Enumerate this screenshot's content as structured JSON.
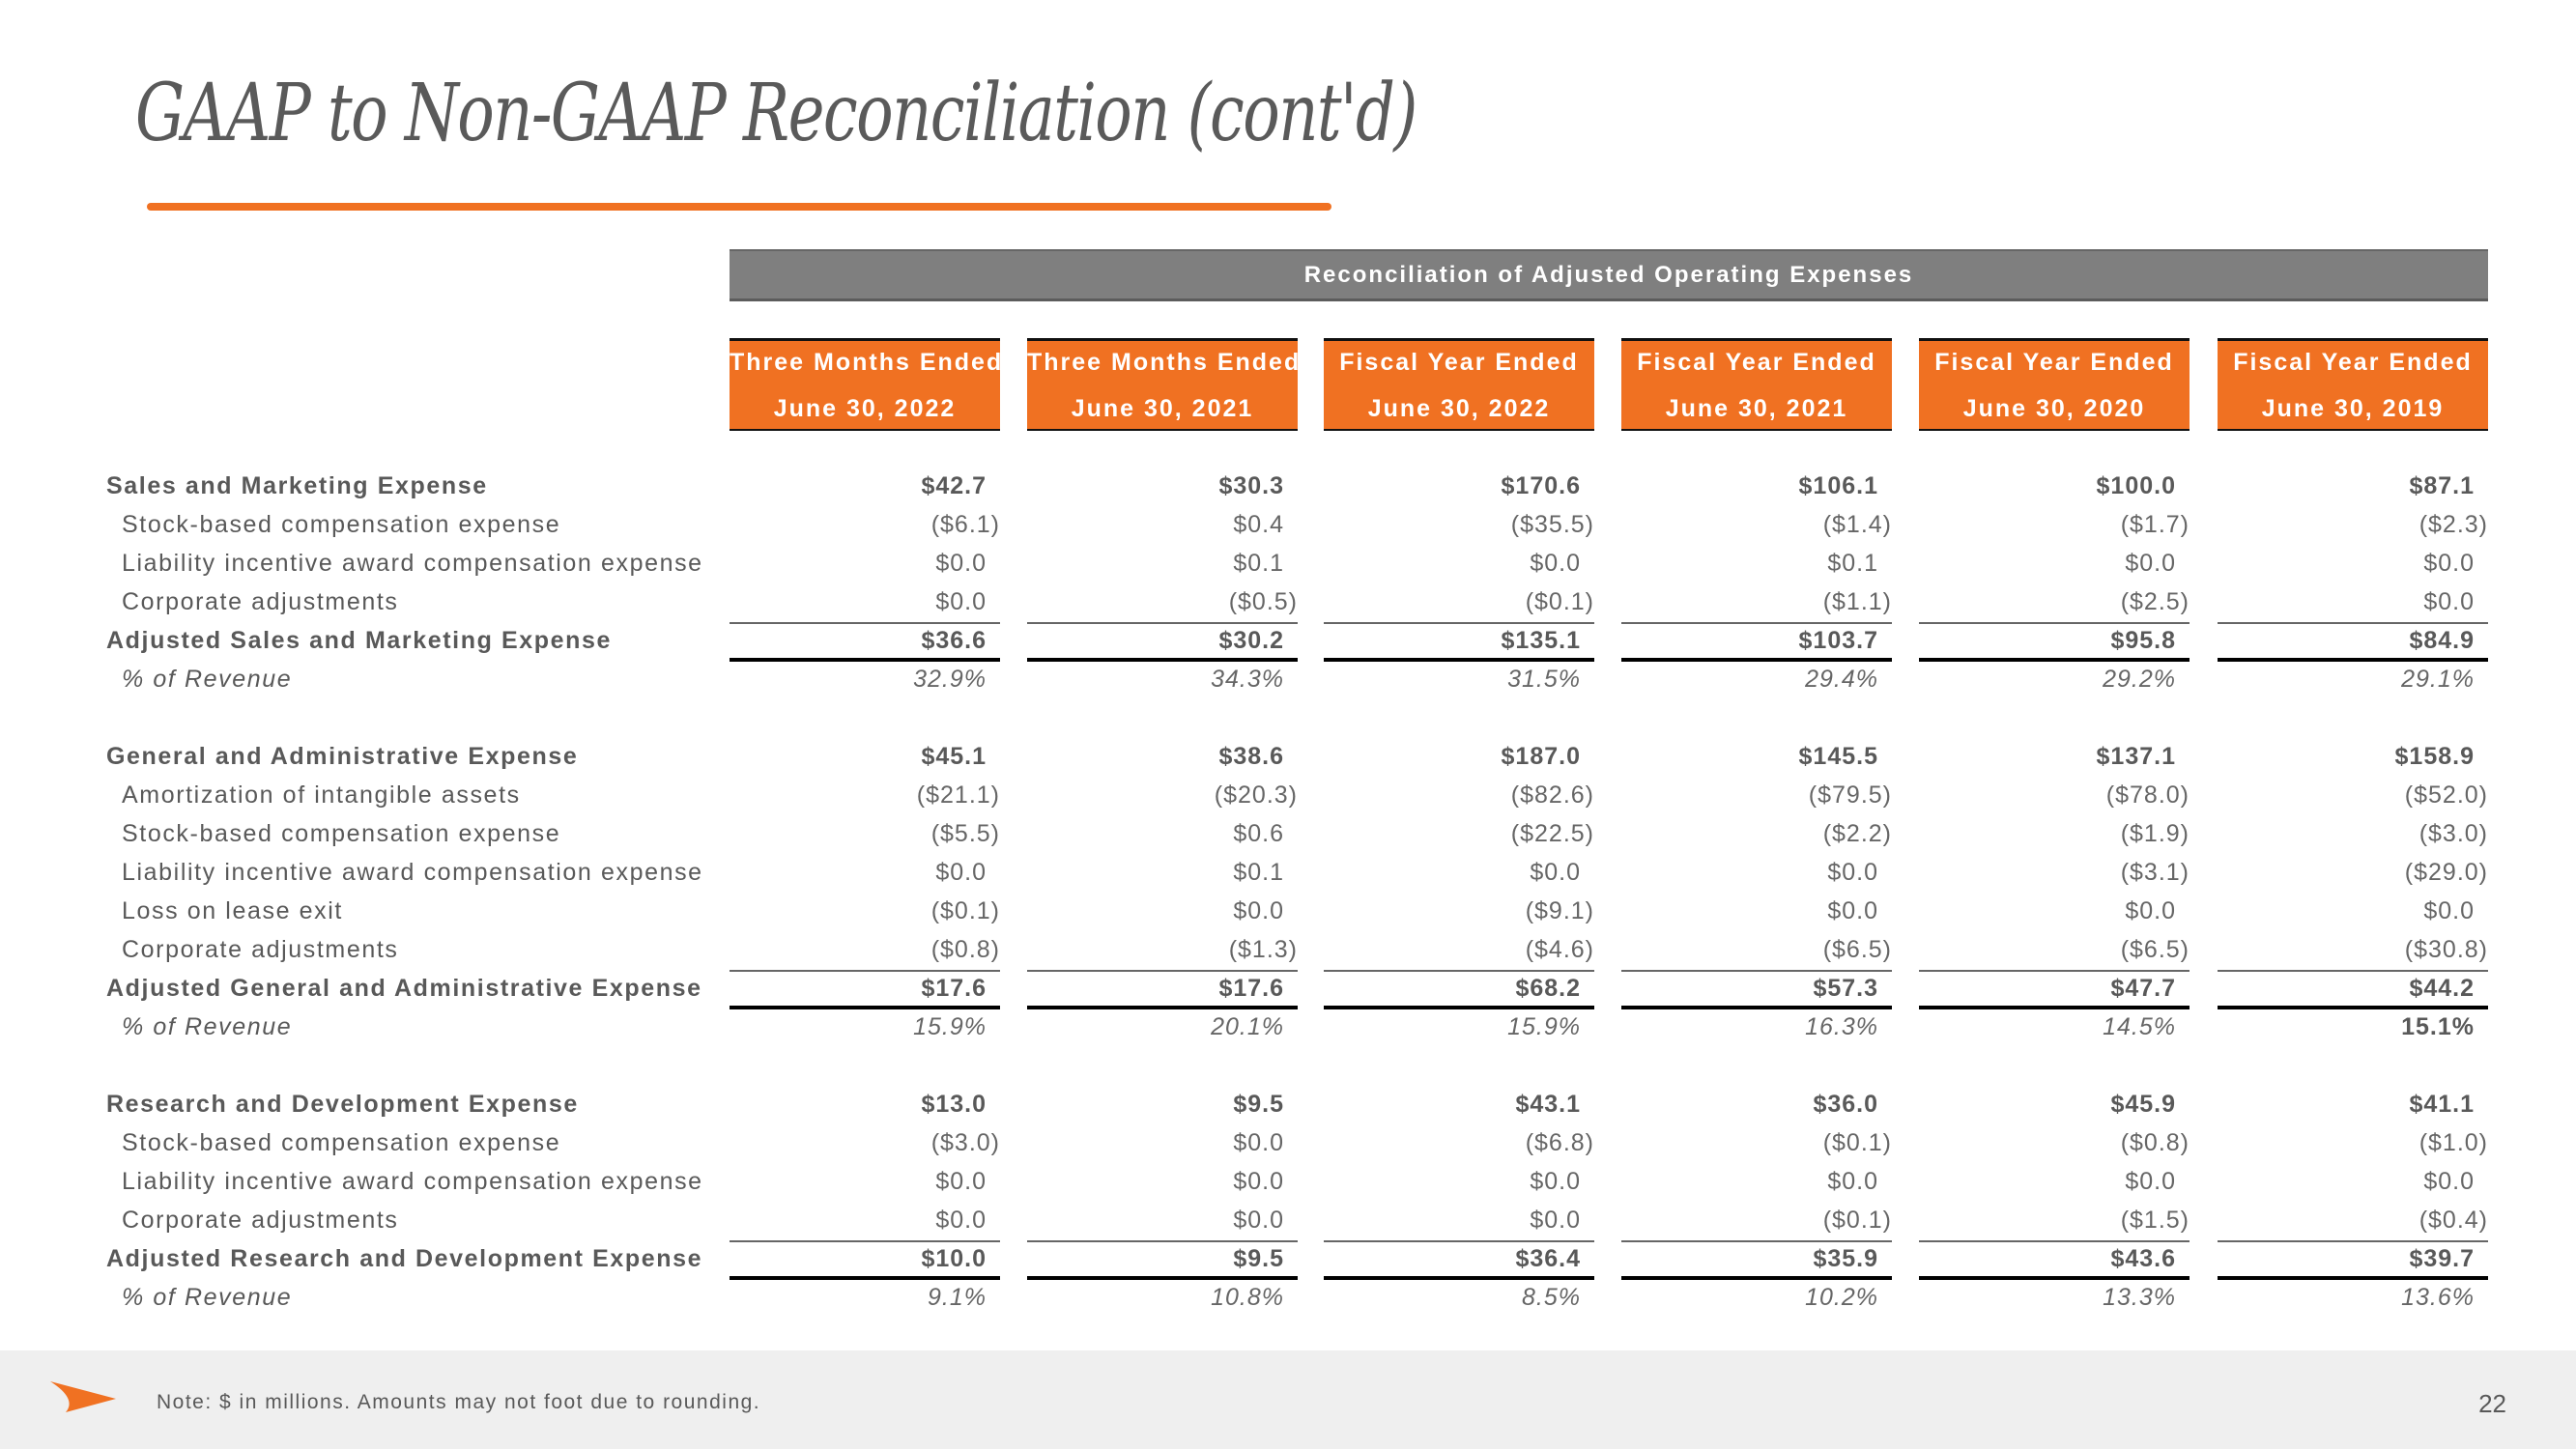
{
  "slide": {
    "title": "GAAP to Non-GAAP Reconciliation (cont'd)",
    "banner": "Reconciliation of Adjusted Operating Expenses",
    "accent_color": "#f07122",
    "banner_color": "#7f7f7f",
    "page_number": "22",
    "footer_note": "Note: $ in millions. Amounts may not foot due to rounding.",
    "footer_icon": "orange-arrow-logo-icon"
  },
  "columns": [
    {
      "line1": "Three Months Ended",
      "line2": "June 30, 2022"
    },
    {
      "line1": "Three Months Ended",
      "line2": "June 30, 2021"
    },
    {
      "line1": "Fiscal Year Ended",
      "line2": "June 30, 2022"
    },
    {
      "line1": "Fiscal Year Ended",
      "line2": "June 30, 2021"
    },
    {
      "line1": "Fiscal Year Ended",
      "line2": "June 30, 2020"
    },
    {
      "line1": "Fiscal Year Ended",
      "line2": "June 30, 2019"
    }
  ],
  "sections": [
    {
      "name": "sales-marketing",
      "rows": [
        {
          "label": "Sales and Marketing Expense",
          "style": "bold",
          "values": [
            "$42.7",
            "$30.3",
            "$170.6",
            "$106.1",
            "$100.0",
            "$87.1"
          ]
        },
        {
          "label": "Stock-based compensation expense",
          "style": "sub",
          "values": [
            "($6.1)",
            "$0.4",
            "($35.5)",
            "($1.4)",
            "($1.7)",
            "($2.3)"
          ]
        },
        {
          "label": "Liability incentive award compensation expense",
          "style": "sub",
          "values": [
            "$0.0",
            "$0.1",
            "$0.0",
            "$0.1",
            "$0.0",
            "$0.0"
          ]
        },
        {
          "label": "Corporate adjustments",
          "style": "sub",
          "values": [
            "$0.0",
            "($0.5)",
            "($0.1)",
            "($1.1)",
            "($2.5)",
            "$0.0"
          ]
        },
        {
          "label": "Adjusted Sales and Marketing Expense",
          "style": "total",
          "values": [
            "$36.6",
            "$30.2",
            "$135.1",
            "$103.7",
            "$95.8",
            "$84.9"
          ]
        },
        {
          "label": "% of Revenue",
          "style": "pct",
          "values": [
            "32.9%",
            "34.3%",
            "31.5%",
            "29.4%",
            "29.2%",
            "29.1%"
          ]
        }
      ]
    },
    {
      "name": "general-administrative",
      "rows": [
        {
          "label": "General and Administrative Expense",
          "style": "bold",
          "values": [
            "$45.1",
            "$38.6",
            "$187.0",
            "$145.5",
            "$137.1",
            "$158.9"
          ]
        },
        {
          "label": "Amortization of intangible assets",
          "style": "sub",
          "values": [
            "($21.1)",
            "($20.3)",
            "($82.6)",
            "($79.5)",
            "($78.0)",
            "($52.0)"
          ]
        },
        {
          "label": "Stock-based compensation expense",
          "style": "sub",
          "values": [
            "($5.5)",
            "$0.6",
            "($22.5)",
            "($2.2)",
            "($1.9)",
            "($3.0)"
          ]
        },
        {
          "label": "Liability incentive award compensation expense",
          "style": "sub",
          "values": [
            "$0.0",
            "$0.1",
            "$0.0",
            "$0.0",
            "($3.1)",
            "($29.0)"
          ]
        },
        {
          "label": "Loss on lease exit",
          "style": "sub",
          "values": [
            "($0.1)",
            "$0.0",
            "($9.1)",
            "$0.0",
            "$0.0",
            "$0.0"
          ]
        },
        {
          "label": "Corporate adjustments",
          "style": "sub",
          "values": [
            "($0.8)",
            "($1.3)",
            "($4.6)",
            "($6.5)",
            "($6.5)",
            "($30.8)"
          ]
        },
        {
          "label": "Adjusted General and Administrative Expense",
          "style": "total",
          "values": [
            "$17.6",
            "$17.6",
            "$68.2",
            "$57.3",
            "$47.7",
            "$44.2"
          ]
        },
        {
          "label": "% of Revenue",
          "style": "pct",
          "values": [
            "15.9%",
            "20.1%",
            "15.9%",
            "16.3%",
            "14.5%",
            "15.1%"
          ],
          "bold_value_indexes": [
            5
          ]
        }
      ]
    },
    {
      "name": "research-development",
      "rows": [
        {
          "label": "Research and Development Expense",
          "style": "bold",
          "values": [
            "$13.0",
            "$9.5",
            "$43.1",
            "$36.0",
            "$45.9",
            "$41.1"
          ]
        },
        {
          "label": "Stock-based compensation expense",
          "style": "sub",
          "values": [
            "($3.0)",
            "$0.0",
            "($6.8)",
            "($0.1)",
            "($0.8)",
            "($1.0)"
          ]
        },
        {
          "label": "Liability incentive award compensation expense",
          "style": "sub",
          "values": [
            "$0.0",
            "$0.0",
            "$0.0",
            "$0.0",
            "$0.0",
            "$0.0"
          ]
        },
        {
          "label": "Corporate adjustments",
          "style": "sub",
          "values": [
            "$0.0",
            "$0.0",
            "$0.0",
            "($0.1)",
            "($1.5)",
            "($0.4)"
          ]
        },
        {
          "label": "Adjusted Research and Development Expense",
          "style": "total",
          "values": [
            "$10.0",
            "$9.5",
            "$36.4",
            "$35.9",
            "$43.6",
            "$39.7"
          ]
        },
        {
          "label": "% of Revenue",
          "style": "pct",
          "values": [
            "9.1%",
            "10.8%",
            "8.5%",
            "10.2%",
            "13.3%",
            "13.6%"
          ]
        }
      ]
    }
  ]
}
